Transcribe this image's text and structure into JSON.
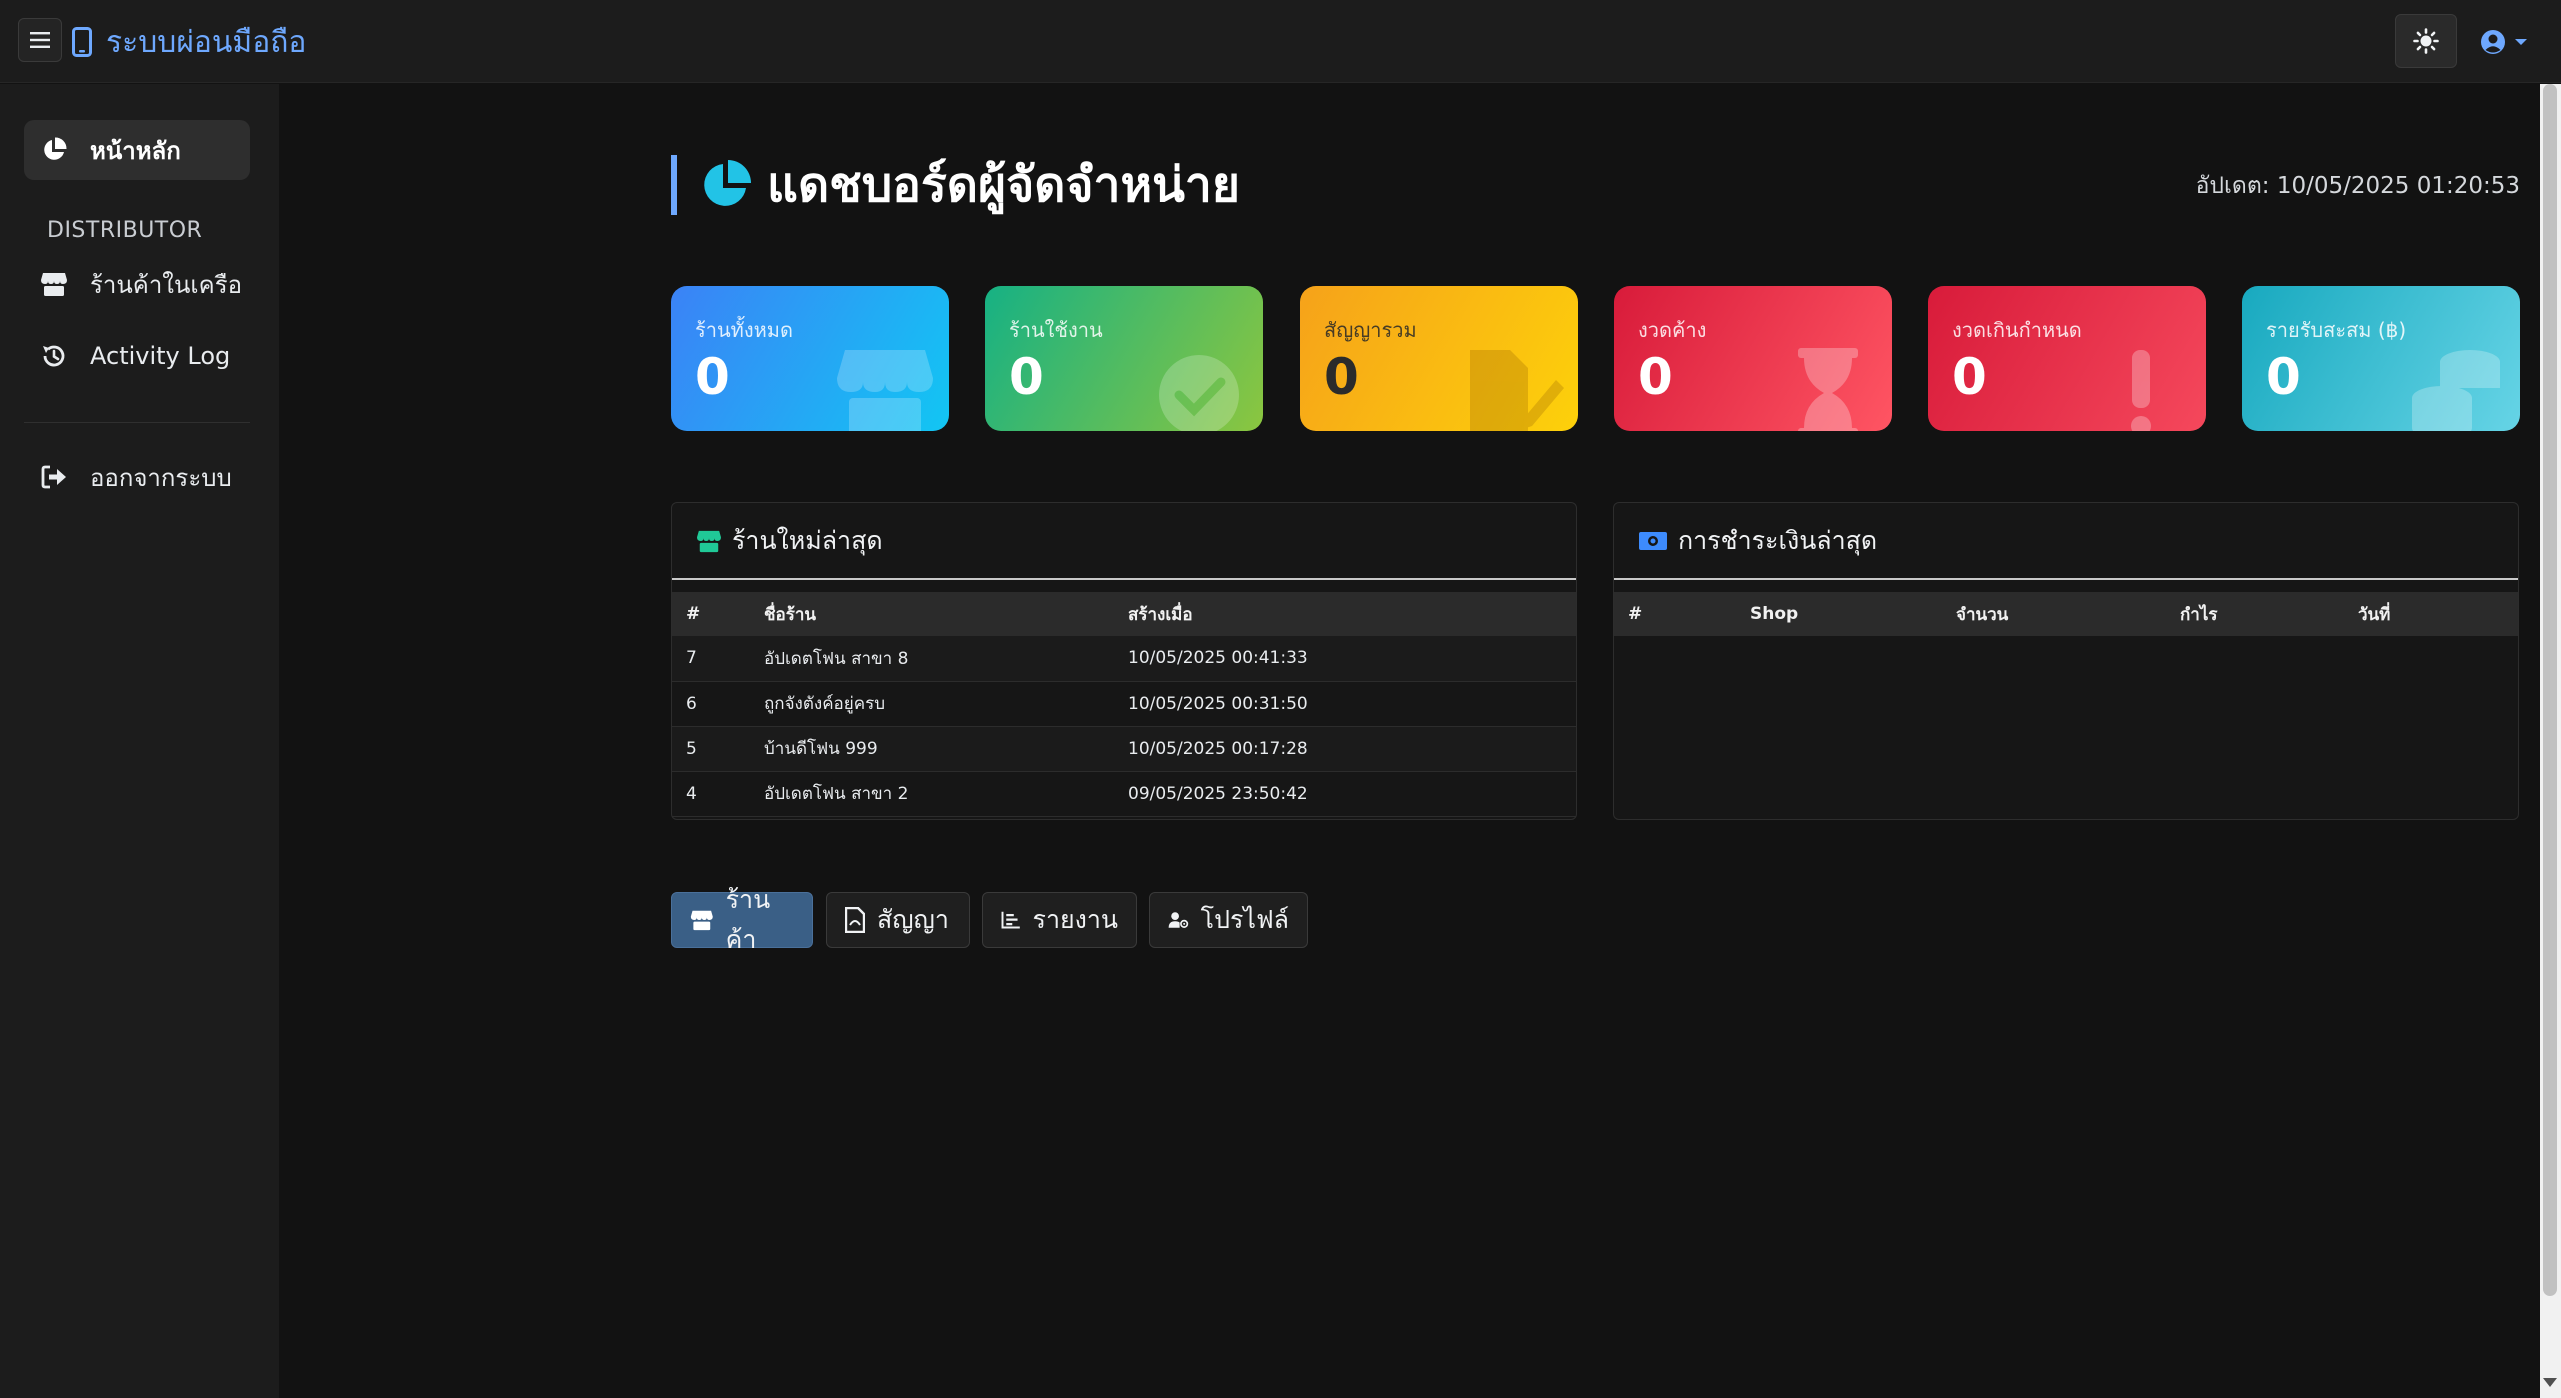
{
  "app": {
    "brand": "ระบบผ่อนมือถือ"
  },
  "sidebar": {
    "home": "หน้าหลัก",
    "section": "DISTRIBUTOR",
    "items": [
      {
        "label": "ร้านค้าในเครือ",
        "icon": "store-icon"
      },
      {
        "label": "Activity Log",
        "icon": "history-icon"
      }
    ],
    "logout": "ออกจากระบบ"
  },
  "header": {
    "title": "แดชบอร์ดผู้จัดจำหน่าย",
    "updated": "อัปเดต: 10/05/2025 01:20:53"
  },
  "stats": [
    {
      "label": "ร้านทั้งหมด",
      "value": "0",
      "color_from": "#3b82f6",
      "color_to": "#12c6f3",
      "icon": "store-icon"
    },
    {
      "label": "ร้านใช้งาน",
      "value": "0",
      "color_from": "#16b184",
      "color_to": "#8cc63f",
      "icon": "check-circle-icon"
    },
    {
      "label": "สัญญารวม",
      "value": "0",
      "color_from": "#f6a21a",
      "color_to": "#fdd10a",
      "icon": "file-signature-icon"
    },
    {
      "label": "งวดค้าง",
      "value": "0",
      "color_from": "#d81b3a",
      "color_to": "#ff5563",
      "icon": "hourglass-icon"
    },
    {
      "label": "งวดเกินกำหนด",
      "value": "0",
      "color_from": "#d81b3a",
      "color_to": "#f5485c",
      "icon": "exclamation-icon"
    },
    {
      "label": "รายรับสะสม (฿)",
      "value": "0",
      "color_from": "#18a9bf",
      "color_to": "#66d4e6",
      "icon": "coins-icon"
    }
  ],
  "new_shops": {
    "title": "ร้านใหม่ล่าสุด",
    "columns": [
      "#",
      "ชื่อร้าน",
      "สร้างเมื่อ"
    ],
    "rows": [
      [
        "7",
        "อัปเดตโฟน สาขา 8",
        "10/05/2025 00:41:33"
      ],
      [
        "6",
        "ถูกจังตังค์อยู่ครบ",
        "10/05/2025 00:31:50"
      ],
      [
        "5",
        "บ้านดีโฟน 999",
        "10/05/2025 00:17:28"
      ],
      [
        "4",
        "อัปเดตโฟน สาขา 2",
        "09/05/2025 23:50:42"
      ]
    ]
  },
  "payments": {
    "title": "การชำระเงินล่าสุด",
    "columns": [
      "#",
      "Shop",
      "จำนวน",
      "กำไร",
      "วันที่"
    ]
  },
  "quick_links": [
    "ร้านค้า",
    "สัญญา",
    "รายงาน",
    "โปรไฟล์"
  ],
  "colors": {
    "accent": "#6ea8fe",
    "background": "#121212",
    "sidebar": "#1c1c1c",
    "primary_button": "#3a5f86"
  }
}
